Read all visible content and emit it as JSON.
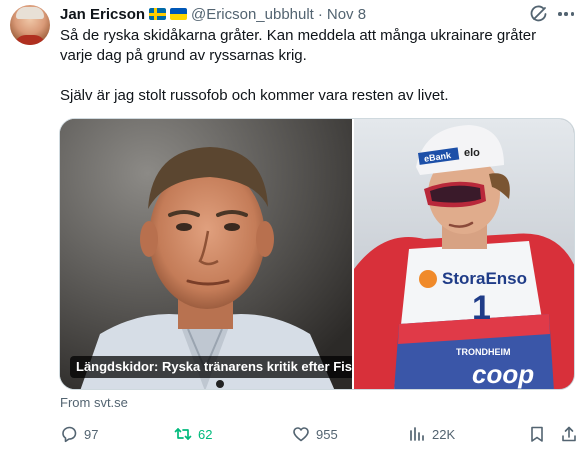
{
  "author": {
    "name": "Jan Ericson",
    "handle": "@Ericson_ubbhult",
    "separator": "·",
    "date": "Nov 8"
  },
  "tweet": {
    "line1": "Så de ryska skidåkarna gråter. Kan meddela att många ukrainare gråter",
    "line2": "varje dag på grund av ryssarnas krig.",
    "line3": "Själv är jag stolt russofob och kommer vara resten av livet."
  },
  "media": {
    "caption": "Längdskidor: Ryska tränarens kritik efter Fis beslut: ”Luktar russofobi”",
    "source": "From svt.se",
    "right_photo_texts": {
      "hat_sponsor": "eBank",
      "hat_brand": "elo",
      "bib_sponsor": "StoraEnso",
      "bib_number": "1",
      "bib_bottom": "coop",
      "bib_city": "TRONDHEIM"
    }
  },
  "actions": {
    "replies": "97",
    "retweets": "62",
    "likes": "955",
    "views": "22K"
  },
  "colors": {
    "text": "#0f1419",
    "secondary": "#536471",
    "retweet_active": "#00ba7c"
  },
  "icons": {
    "grok": "grok-icon",
    "more": "more-icon",
    "reply": "reply-icon",
    "retweet": "retweet-icon",
    "like": "heart-icon",
    "views": "views-icon",
    "bookmark": "bookmark-icon",
    "share": "share-icon"
  }
}
